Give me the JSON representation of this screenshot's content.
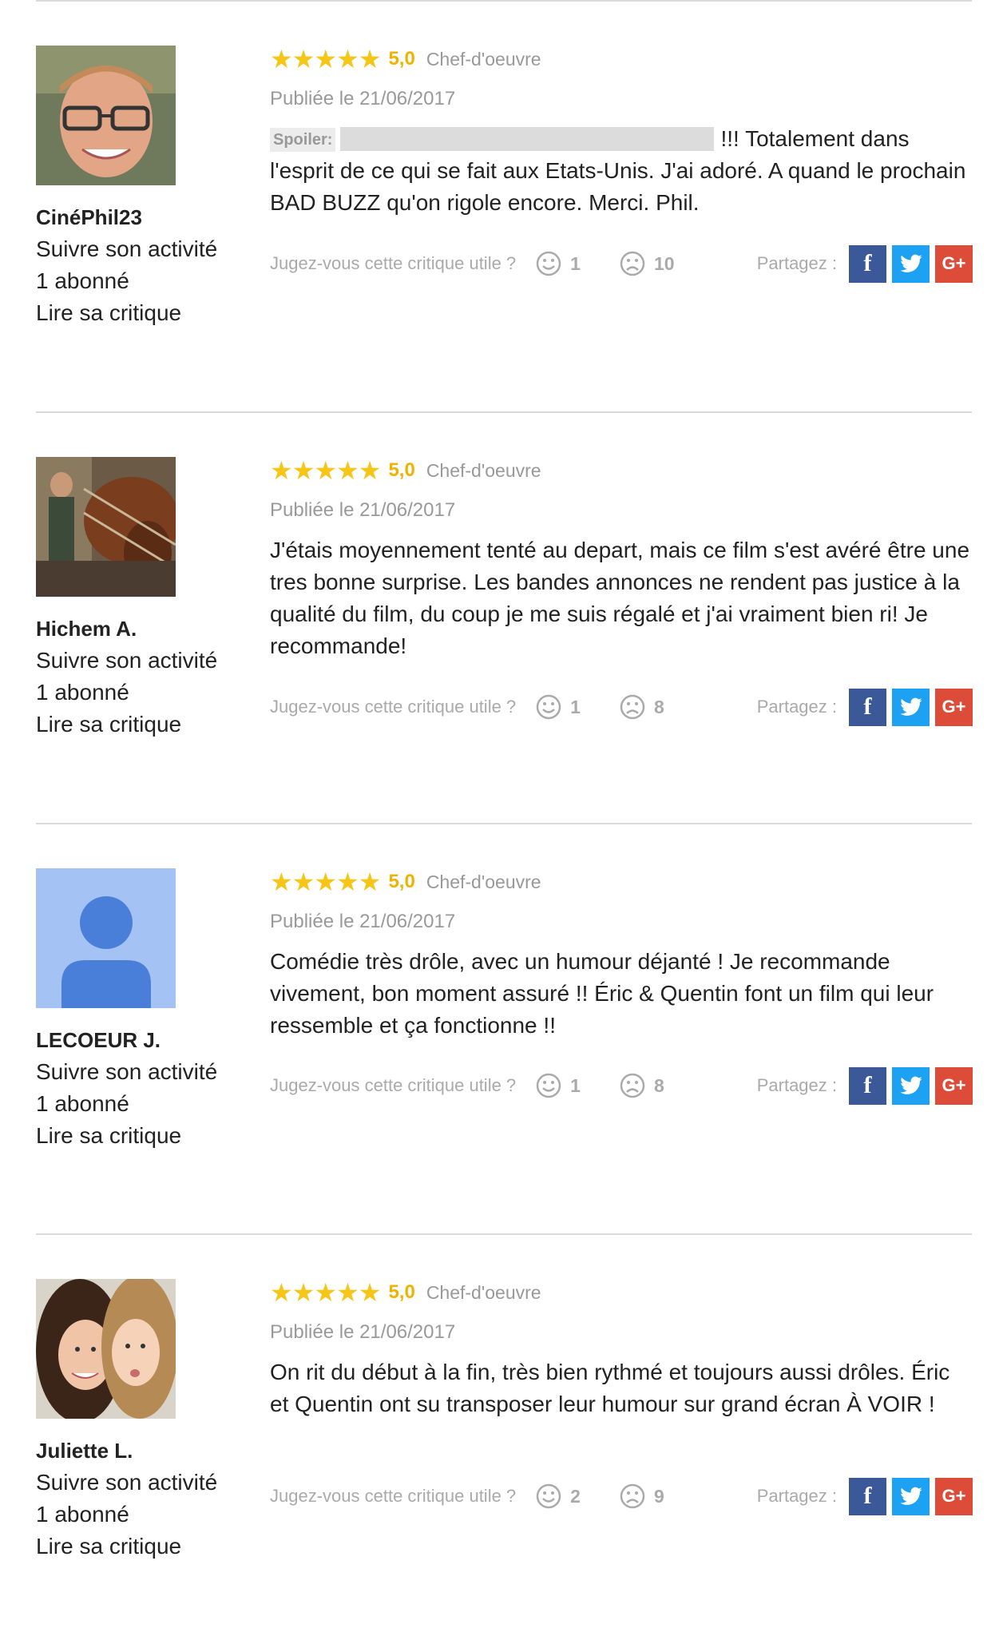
{
  "rating_label_default": "Chef-d'oeuvre",
  "share_label": "Partagez :",
  "useful_question": "Jugez-vous cette critique utile ?",
  "colors": {
    "star": "#f5c518",
    "facebook": "#3b5998",
    "twitter": "#1da1f2",
    "googleplus": "#dd4b39"
  },
  "icons": {
    "positive": "smile-icon",
    "negative": "frown-icon",
    "facebook": "facebook-icon",
    "twitter": "twitter-icon",
    "googleplus": "googleplus-icon"
  },
  "reviews": [
    {
      "author": "CinéPhil23",
      "follow": "Suivre son activité",
      "followers": "1 abonné",
      "read": "Lire sa critique",
      "stars": "★★★★★",
      "rating": "5,0",
      "rating_label": "Chef-d'oeuvre",
      "date": "Publiée le 21/06/2017",
      "spoiler_label": "Spoiler:",
      "text": "!!! Totalement dans l'esprit de ce qui se fait aux Etats-Unis. J'ai adoré. A quand le prochain BAD BUZZ qu'on rigole encore. Merci. Phil.",
      "positive_votes": "1",
      "negative_votes": "10"
    },
    {
      "author": "Hichem A.",
      "follow": "Suivre son activité",
      "followers": "1 abonné",
      "read": "Lire sa critique",
      "stars": "★★★★★",
      "rating": "5,0",
      "rating_label": "Chef-d'oeuvre",
      "date": "Publiée le 21/06/2017",
      "text": "J'étais moyennement tenté au depart, mais ce film s'est avéré être une tres bonne surprise. Les bandes annonces ne rendent pas justice à la qualité du film, du coup je me suis régalé et j'ai vraiment bien ri! Je recommande!",
      "positive_votes": "1",
      "negative_votes": "8"
    },
    {
      "author": "LECOEUR J.",
      "follow": "Suivre son activité",
      "followers": "1 abonné",
      "read": "Lire sa critique",
      "stars": "★★★★★",
      "rating": "5,0",
      "rating_label": "Chef-d'oeuvre",
      "date": "Publiée le 21/06/2017",
      "text": "Comédie très drôle, avec un humour déjanté ! Je recommande vivement, bon moment assuré !! Éric & Quentin font un film qui leur ressemble et ça fonctionne !!",
      "positive_votes": "1",
      "negative_votes": "8"
    },
    {
      "author": "Juliette L.",
      "follow": "Suivre son activité",
      "followers": "1 abonné",
      "read": "Lire sa critique",
      "stars": "★★★★★",
      "rating": "5,0",
      "rating_label": "Chef-d'oeuvre",
      "date": "Publiée le 21/06/2017",
      "text": "On rit du début à la fin, très bien rythmé et toujours aussi drôles. Éric et Quentin ont su transposer leur humour sur grand écran À VOIR !",
      "positive_votes": "2",
      "negative_votes": "9"
    }
  ]
}
